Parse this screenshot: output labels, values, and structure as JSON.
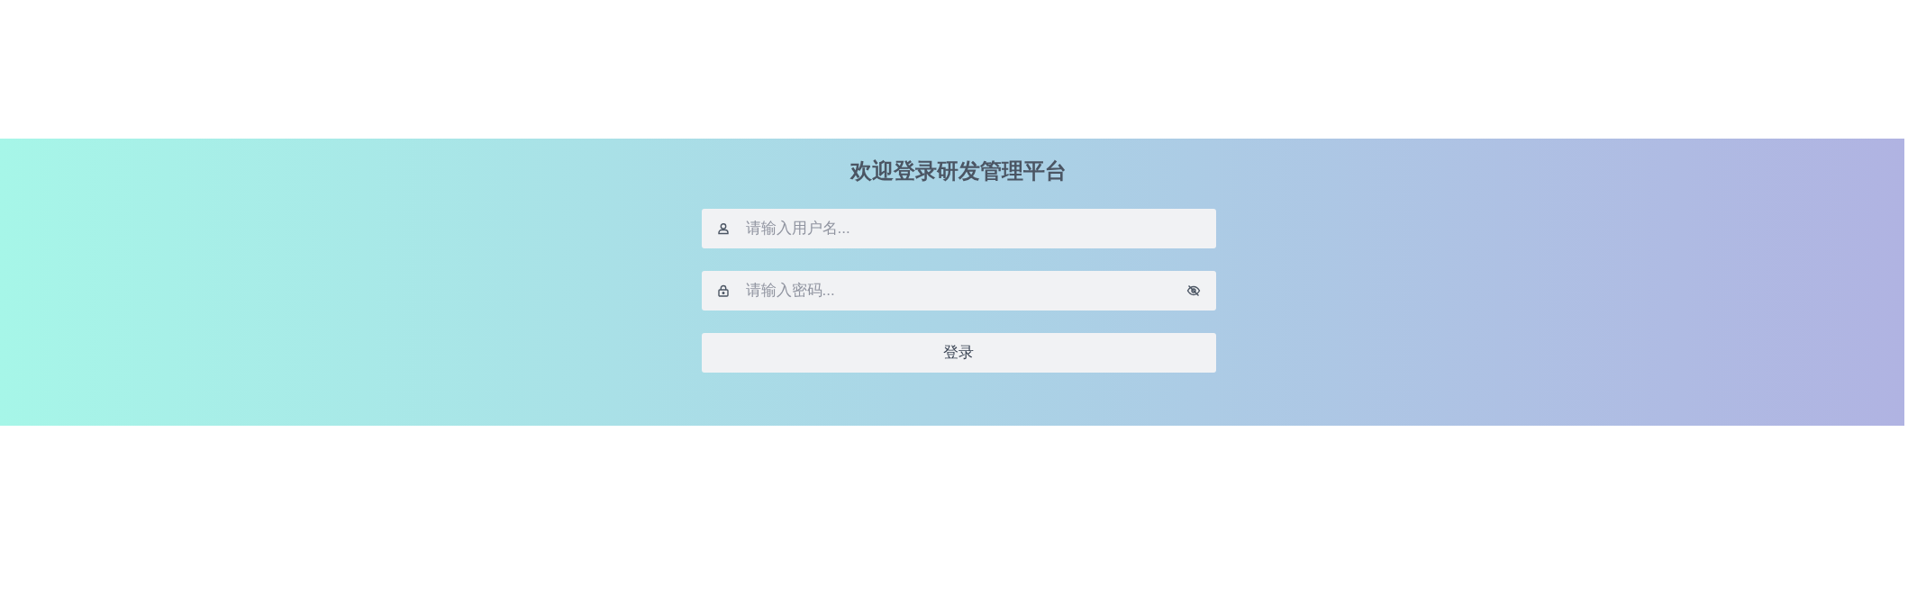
{
  "title": "欢迎登录研发管理平台",
  "fields": [
    {
      "kind": "username",
      "placeholder": "请输入用户名..."
    },
    {
      "kind": "password",
      "placeholder": "请输入密码...",
      "password_visible": false
    }
  ],
  "button": "登录"
}
